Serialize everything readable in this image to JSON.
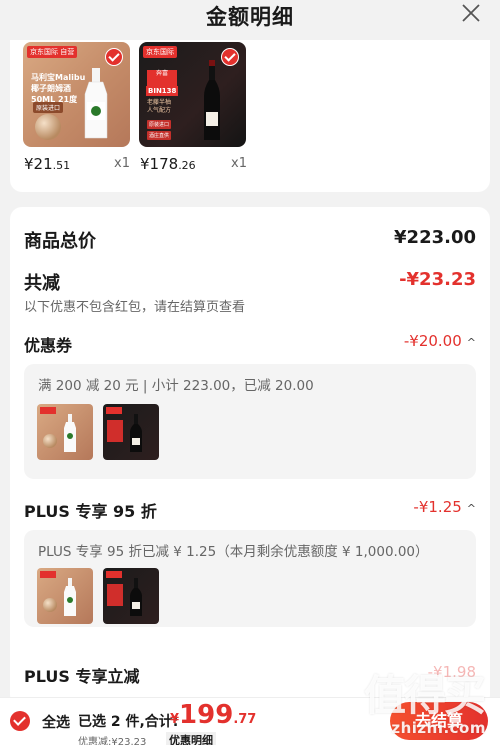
{
  "header": {
    "title": "金额明细",
    "close_icon": "close-icon"
  },
  "products": [
    {
      "store_tag": "京东国际 自营",
      "promo_text": "马利宝Malibu\n椰子朗姆酒\n50ML 21度",
      "promo_btn": "原装进口",
      "price_int": "¥21",
      "price_dec": ".51",
      "qty": "x1"
    },
    {
      "store_tag": "京东国际",
      "red_label": "奔富",
      "bin": "BIN138",
      "sub_text": "老藤半柚\n人气配方",
      "btns": [
        "原装进口",
        "酒庄直供"
      ],
      "price_int": "¥178",
      "price_dec": ".26",
      "qty": "x1"
    }
  ],
  "summary": {
    "total_label": "商品总价",
    "total_value": "¥223.00",
    "reduce_label": "共减",
    "reduce_value": "-¥23.23",
    "reduce_note": "以下优惠不包含红包，请在结算页查看",
    "coupon_label": "优惠券",
    "coupon_value": "-¥20.00",
    "coupon_panel": "满 200 减 20 元 | 小计 223.00，已减 20.00",
    "plus95_label": "PLUS 专享 95 折",
    "plus95_value": "-¥1.25",
    "plus95_panel": "PLUS 专享 95 折已减 ¥ 1.25（本月剩余优惠额度 ¥ 1,000.00）",
    "plus_instant_label": "PLUS 专享立减",
    "plus_instant_value": "-¥1.98"
  },
  "bottom": {
    "select_all": "全选",
    "selected_text": "已选 2 件,合计:",
    "currency": "¥",
    "total_int": "199",
    "total_dec": ".77",
    "discount_text": "优惠减:¥23.23",
    "detail_link": "优惠明细",
    "checkout": "去结算"
  },
  "watermark": {
    "glyphs": "值得买",
    "text": "zhizhi.com"
  }
}
